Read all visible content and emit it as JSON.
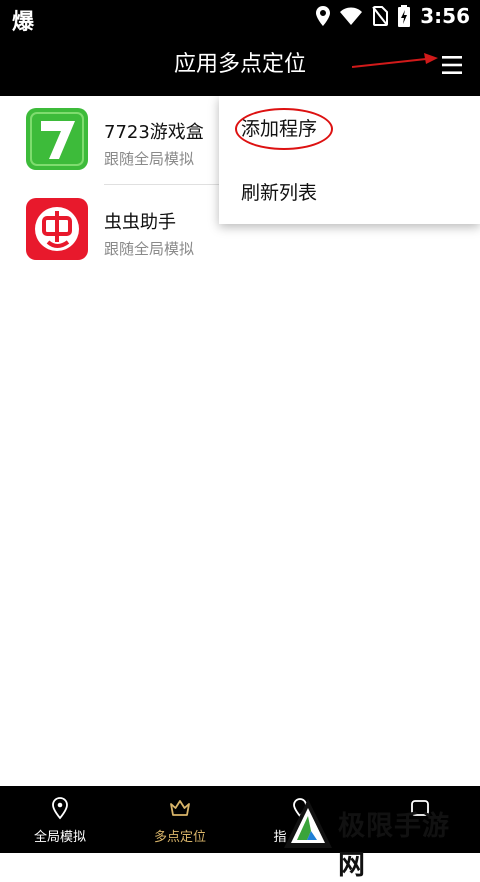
{
  "status_bar": {
    "left_glyph": "爆",
    "time": "3:56",
    "icons": [
      "location-icon",
      "wifi-icon",
      "no-sim-icon",
      "battery-charging-icon"
    ]
  },
  "app_bar": {
    "title": "应用多点定位",
    "menu_icon": "hamburger-menu-icon",
    "annotation_color": "#d11a1a"
  },
  "apps": [
    {
      "name": "7723游戏盒",
      "subtitle": "跟随全局模拟",
      "icon": "7723-app-icon",
      "icon_color": "#3dbb3a"
    },
    {
      "name": "虫虫助手",
      "subtitle": "跟随全局模拟",
      "icon": "chongchong-app-icon",
      "icon_color": "#e8192c"
    }
  ],
  "popup_menu": {
    "items": [
      "添加程序",
      "刷新列表"
    ]
  },
  "bottom_nav": {
    "items": [
      {
        "label": "全局模拟",
        "icon": "location-pin-icon",
        "active": false
      },
      {
        "label": "多点定位",
        "icon": "crown-icon",
        "active": true
      },
      {
        "label": "指",
        "icon": "location-icon",
        "active": false
      },
      {
        "label": "",
        "icon": "profile-icon",
        "active": false
      }
    ],
    "active_color": "#d9b56a"
  },
  "watermark": {
    "text": "极限手游网",
    "logo": "watermark-logo-icon"
  }
}
